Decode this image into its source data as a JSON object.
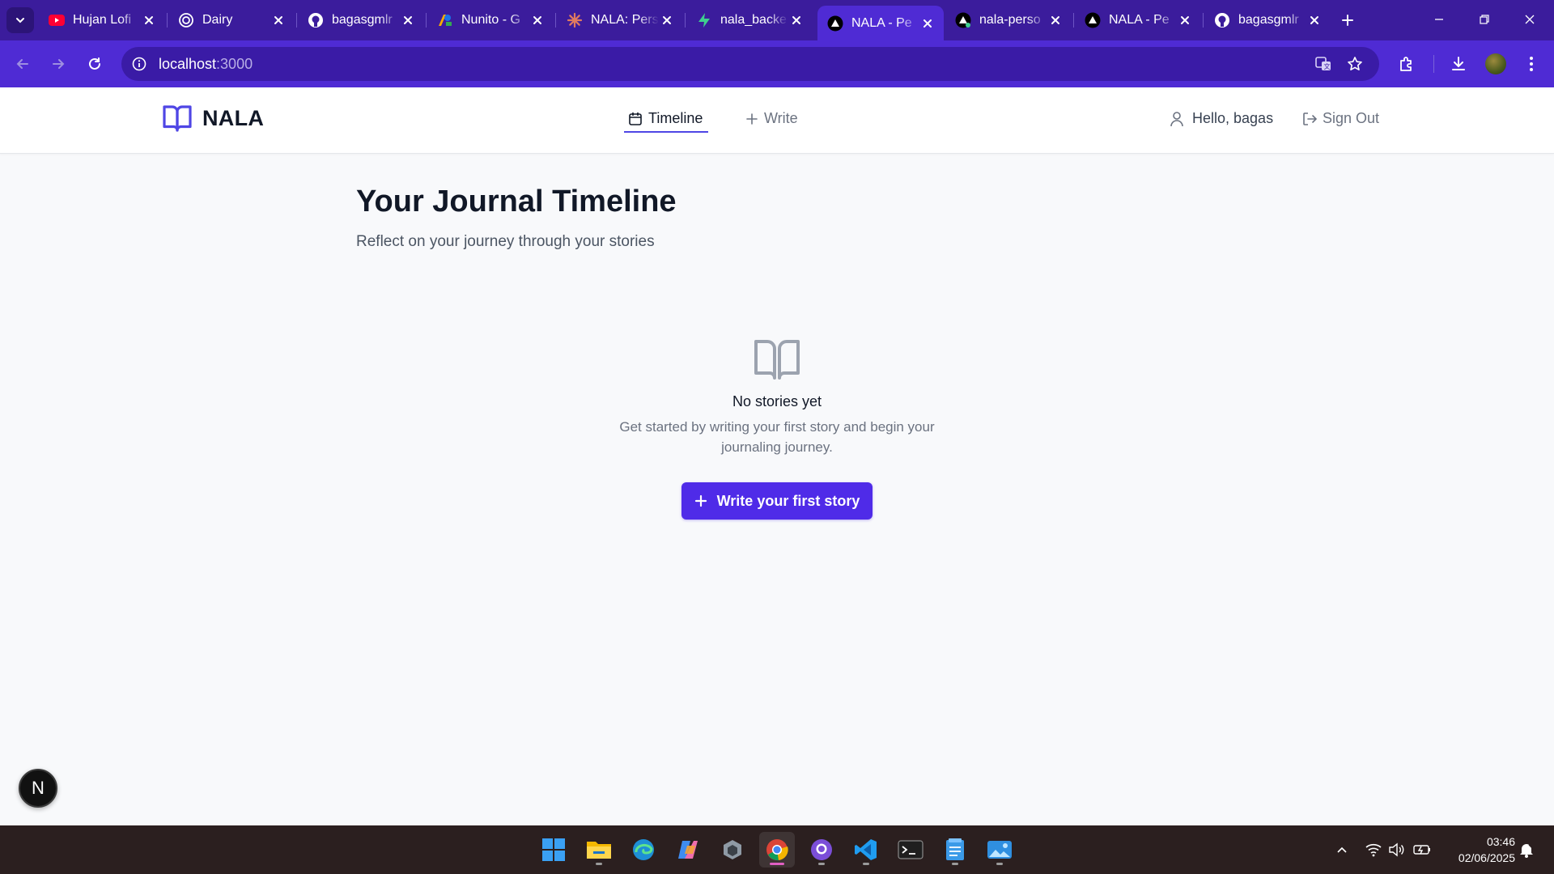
{
  "browser": {
    "tabs": [
      {
        "title": "Hujan Lofi",
        "icon": "youtube-icon"
      },
      {
        "title": "Dairy",
        "icon": "openai-icon"
      },
      {
        "title": "bagasgmlr",
        "icon": "github-icon"
      },
      {
        "title": "Nunito - G",
        "icon": "google-fonts-icon"
      },
      {
        "title": "NALA: Pers",
        "icon": "claude-icon"
      },
      {
        "title": "nala_backe",
        "icon": "supabase-icon"
      },
      {
        "title": "NALA - Pe",
        "icon": "vercel-icon",
        "active": true
      },
      {
        "title": "nala-perso",
        "icon": "vercel-icon"
      },
      {
        "title": "NALA - Pe",
        "icon": "vercel-icon"
      },
      {
        "title": "bagasgmlr",
        "icon": "github-icon"
      }
    ],
    "url_host": "localhost",
    "url_port": ":3000",
    "colors": {
      "tabstrip": "#3b1c9c",
      "toolbar": "#4f2bd4"
    }
  },
  "app": {
    "brand": "NALA",
    "nav": {
      "timeline": "Timeline",
      "write": "Write"
    },
    "user_greeting": "Hello, bagas",
    "sign_out": "Sign Out",
    "accent": "#4f46e5"
  },
  "main": {
    "title": "Your Journal Timeline",
    "subtitle": "Reflect on your journey through your stories",
    "empty_title": "No stories yet",
    "empty_desc": "Get started by writing your first story and begin your journaling journey.",
    "cta": "Write your first story",
    "cta_color": "#4f2be8"
  },
  "dev_badge": "N",
  "taskbar": {
    "apps": [
      "windows-start-icon",
      "file-explorer-icon",
      "edge-icon",
      "copilot-icon",
      "unity-icon",
      "chrome-icon",
      "github-desktop-icon",
      "vscode-icon",
      "terminal-icon",
      "notepad-icon",
      "photos-icon"
    ],
    "time": "03:46",
    "date": "02/06/2025"
  }
}
